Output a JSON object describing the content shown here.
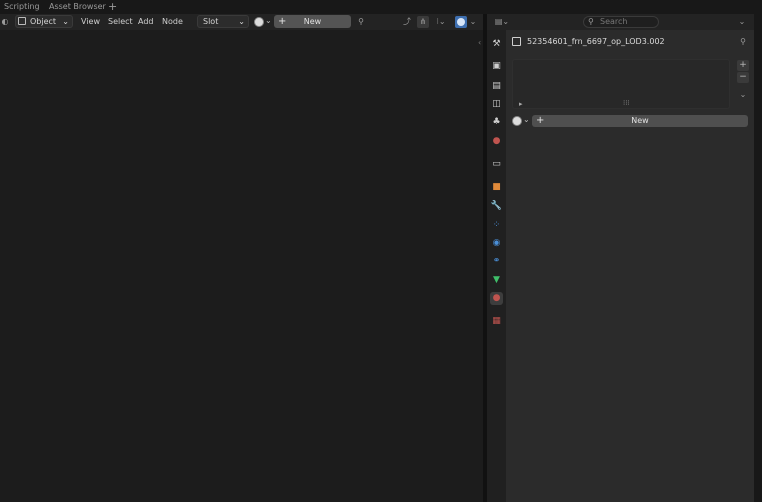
{
  "workspace_tabs": [
    {
      "label": "Scripting"
    },
    {
      "label": "Asset Browser"
    }
  ],
  "add_workspace_label": "+",
  "node_editor": {
    "mode_dropdown": "Object",
    "menus": [
      "View",
      "Select",
      "Add",
      "Node"
    ],
    "slot_dropdown": "Slot",
    "new_button": "New"
  },
  "properties": {
    "search_placeholder": "Search",
    "object_name": "52354601_frn_6697_op_LOD3.002",
    "new_material_button": "New",
    "list_add": "+",
    "list_remove": "−",
    "tabs": [
      {
        "name": "tool-icon",
        "glyph": "⚒",
        "color": "#d0d0d0"
      },
      {
        "name": "render-icon",
        "glyph": "▣",
        "color": "#cfcfcf"
      },
      {
        "name": "output-icon",
        "glyph": "▤",
        "color": "#cfcfcf"
      },
      {
        "name": "view-layer-icon",
        "glyph": "◫",
        "color": "#cfcfcf"
      },
      {
        "name": "scene-icon",
        "glyph": "♣",
        "color": "#cfcfcf"
      },
      {
        "name": "world-icon",
        "glyph": "●",
        "color": "#c0544f"
      },
      {
        "name": "collection-icon",
        "glyph": "▭",
        "color": "#cfcfcf"
      },
      {
        "name": "object-icon",
        "glyph": "■",
        "color": "#e08a3a"
      },
      {
        "name": "modifier-icon",
        "glyph": "🔧",
        "color": "#4a8fd8"
      },
      {
        "name": "particles-icon",
        "glyph": "⁘",
        "color": "#4a8fd8"
      },
      {
        "name": "physics-icon",
        "glyph": "◉",
        "color": "#4a8fd8"
      },
      {
        "name": "constraints-icon",
        "glyph": "⚭",
        "color": "#4a8fd8"
      },
      {
        "name": "data-icon",
        "glyph": "▼",
        "color": "#3fbf6a"
      },
      {
        "name": "material-icon",
        "glyph": "●",
        "color": "#c0544f"
      },
      {
        "name": "texture-icon",
        "glyph": "▦",
        "color": "#c0544f"
      }
    ]
  }
}
